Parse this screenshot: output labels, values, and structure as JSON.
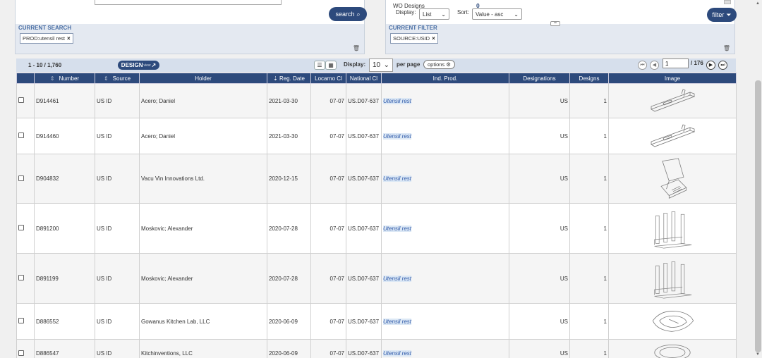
{
  "search": {
    "button_label": "search",
    "section_title": "CURRENT SEARCH",
    "chip_label": "PROD:utensil rest",
    "chip_remove": "×"
  },
  "filter": {
    "wo_designs_label": "WO Designs",
    "wo_designs_count": "0",
    "display_label": "Display:",
    "display_value": "List",
    "sort_label": "Sort:",
    "sort_value": "Value - asc",
    "button_label": "filter",
    "section_title": "CURRENT FILTER",
    "chip_label": "SOURCE:USID",
    "chip_remove": "×"
  },
  "toolbar": {
    "result_count": "1 - 10 / 1,760",
    "design_view_label": "DESIGN",
    "design_view_sub": "view",
    "display_label": "Display:",
    "display_value": "10",
    "per_page_label": "per page",
    "options_label": "options",
    "page_value": "1",
    "page_total": "/ 176"
  },
  "columns": [
    "",
    "Number",
    "Source",
    "Holder",
    "Reg. Date",
    "Locarno Cl",
    "National Cl",
    "Ind. Prod.",
    "Designations",
    "Designs",
    "Image"
  ],
  "rows": [
    {
      "number": "D914461",
      "source": "US ID",
      "holder": "Acero; Daniel",
      "reg_date": "2021-03-30",
      "locarno": "07-07",
      "national": "US.D07-637",
      "prod": "Utensil rest",
      "designations": "US",
      "designs": "1",
      "image": "utensil-rest-bar-icon"
    },
    {
      "number": "D914460",
      "source": "US ID",
      "holder": "Acero; Daniel",
      "reg_date": "2021-03-30",
      "locarno": "07-07",
      "national": "US.D07-637",
      "prod": "Utensil rest",
      "designations": "US",
      "designs": "1",
      "image": "utensil-rest-bar-icon"
    },
    {
      "number": "D904832",
      "source": "US ID",
      "holder": "Vacu Vin Innovations Ltd.",
      "reg_date": "2020-12-15",
      "locarno": "07-07",
      "national": "US.D07-637",
      "prod": "Utensil rest",
      "designations": "US",
      "designs": "1",
      "image": "utensil-rest-stand-icon"
    },
    {
      "number": "D891200",
      "source": "US ID",
      "holder": "Moskovic; Alexander",
      "reg_date": "2020-07-28",
      "locarno": "07-07",
      "national": "US.D07-637",
      "prod": "Utensil rest",
      "designations": "US",
      "designs": "1",
      "image": "utensil-rack-icon"
    },
    {
      "number": "D891199",
      "source": "US ID",
      "holder": "Moskovic; Alexander",
      "reg_date": "2020-07-28",
      "locarno": "07-07",
      "national": "US.D07-637",
      "prod": "Utensil rest",
      "designations": "US",
      "designs": "1",
      "image": "utensil-rack-icon"
    },
    {
      "number": "D886552",
      "source": "US ID",
      "holder": "Gowanus Kitchen Lab, LLC",
      "reg_date": "2020-06-09",
      "locarno": "07-07",
      "national": "US.D07-637",
      "prod": "Utensil rest",
      "designations": "US",
      "designs": "1",
      "image": "utensil-tray-icon"
    },
    {
      "number": "D886547",
      "source": "US ID",
      "holder": "Kitchinventions, LLC",
      "reg_date": "2020-06-09",
      "locarno": "07-07",
      "national": "US.D07-637",
      "prod": "Utensil rest",
      "designations": "US",
      "designs": "1",
      "image": "utensil-bowl-icon"
    }
  ]
}
